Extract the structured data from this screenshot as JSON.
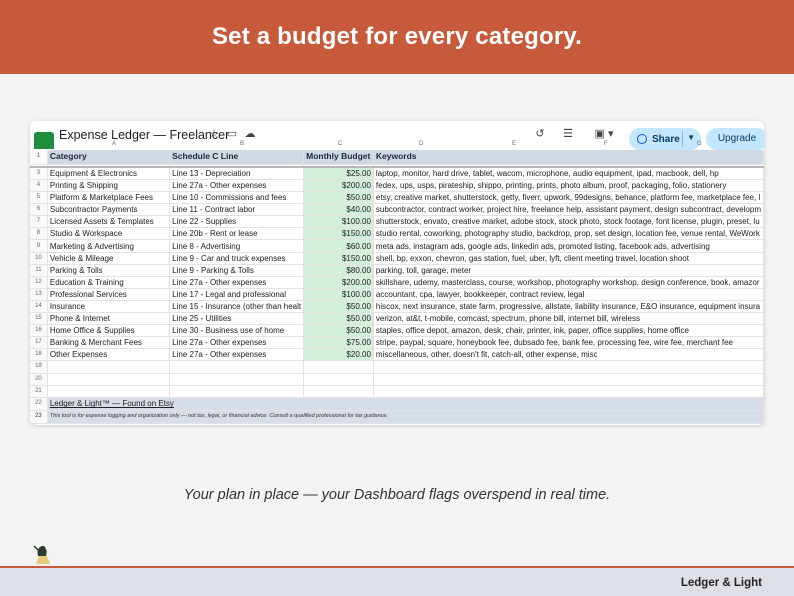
{
  "banner": {
    "title": "Set a budget for every category."
  },
  "app": {
    "doc_title": "Expense Ledger — Freelancer",
    "share_label": "Share",
    "upgrade_label": "Upgrade"
  },
  "columns": {
    "a": "A",
    "b": "B",
    "c": "C",
    "d": "D",
    "e": "E",
    "f": "F",
    "g": "G"
  },
  "sheet": {
    "header": {
      "row": "1",
      "category": "Category",
      "schedule": "Schedule C Line",
      "budget": "Monthly Budget",
      "keywords": "Keywords"
    },
    "rows": [
      {
        "n": "3",
        "category": "Equipment & Electronics",
        "schedule": "Line 13 - Depreciation",
        "budget": "$25.00",
        "keywords": "laptop, monitor, hard drive, tablet, wacom, microphone, audio equipment, ipad, macbook, dell, hp"
      },
      {
        "n": "4",
        "category": "Printing & Shipping",
        "schedule": "Line 27a - Other expenses",
        "budget": "$200.00",
        "keywords": "fedex, ups, usps, pirateship, shippo, printing, prints, photo album, proof, packaging, folio, stationery"
      },
      {
        "n": "5",
        "category": "Platform & Marketplace Fees",
        "schedule": "Line 10 - Commissions and fees",
        "budget": "$50.00",
        "keywords": "etsy, creative market, shutterstock, getty, fiverr, upwork, 99designs, behance, platform fee, marketplace fee, l"
      },
      {
        "n": "6",
        "category": "Subcontractor Payments",
        "schedule": "Line 11 - Contract labor",
        "budget": "$40.00",
        "keywords": "subcontractor, contract worker, project hire, freelance help, assistant payment, design subcontract, developm"
      },
      {
        "n": "7",
        "category": "Licensed Assets & Templates",
        "schedule": "Line 22 - Supplies",
        "budget": "$100.00",
        "keywords": "shutterstock, envato, creative market, adobe stock, stock photo, stock footage, font license, plugin, preset, lu"
      },
      {
        "n": "8",
        "category": "Studio & Workspace",
        "schedule": "Line 20b - Rent or lease",
        "budget": "$150.00",
        "keywords": "studio rental, coworking, photography studio, backdrop, prop, set design, location fee, venue rental, WeWork"
      },
      {
        "n": "9",
        "category": "Marketing & Advertising",
        "schedule": "Line 8 - Advertising",
        "budget": "$60.00",
        "keywords": "meta ads, instagram ads, google ads, linkedin ads, promoted listing, facebook ads, advertising"
      },
      {
        "n": "10",
        "category": "Vehicle & Mileage",
        "schedule": "Line 9 - Car and truck expenses",
        "budget": "$150.00",
        "keywords": "shell, bp, exxon, chevron, gas station, fuel, uber, lyft, client meeting travel, location shoot"
      },
      {
        "n": "11",
        "category": "Parking & Tolls",
        "schedule": "Line 9 - Parking & Tolls",
        "budget": "$80.00",
        "keywords": "parking, toll, garage, meter"
      },
      {
        "n": "12",
        "category": "Education & Training",
        "schedule": "Line 27a - Other expenses",
        "budget": "$200.00",
        "keywords": "skillshare, udemy, masterclass, course, workshop, photography workshop, design conference, book, amazor"
      },
      {
        "n": "13",
        "category": "Professional Services",
        "schedule": "Line 17 - Legal and professional",
        "budget": "$100.00",
        "keywords": "accountant, cpa, lawyer, bookkeeper, contract review, legal"
      },
      {
        "n": "14",
        "category": "Insurance",
        "schedule": "Line 15 - Insurance (other than healt",
        "budget": "$50.00",
        "keywords": "hiscox, next insurance, state farm, progressive, allstate, liability insurance, E&O insurance, equipment insura"
      },
      {
        "n": "15",
        "category": "Phone & Internet",
        "schedule": "Line 25 - Utilities",
        "budget": "$50.00",
        "keywords": "verizon, at&t, t-mobile, comcast, spectrum, phone bill, internet bill, wireless"
      },
      {
        "n": "16",
        "category": "Home Office & Supplies",
        "schedule": "Line 30 - Business use of home",
        "budget": "$50.00",
        "keywords": "staples, office depot, amazon, desk, chair, printer, ink, paper, office supplies, home office"
      },
      {
        "n": "17",
        "category": "Banking & Merchant Fees",
        "schedule": "Line 27a - Other expenses",
        "budget": "$75.00",
        "keywords": "stripe, paypal, square, honeybook fee, dubsado fee, bank fee, processing fee, wire fee, merchant fee"
      },
      {
        "n": "18",
        "category": "Other Expenses",
        "schedule": "Line 27a - Other expenses",
        "budget": "$20.00",
        "keywords": "miscellaneous, other, doesn't fit, catch-all, other expense, misc"
      }
    ],
    "empty_rows": [
      "19",
      "20",
      "21"
    ],
    "brand_row": {
      "n": "22",
      "text": "Ledger & Light™  —  Found on Etsy"
    },
    "disclaimer_row": {
      "n": "23",
      "text": "This tool is for expense logging and organization only — not tax, legal, or financial advice. Consult a qualified professional for tax guidance."
    }
  },
  "caption": "Your plan in place — your Dashboard flags overspend in real time.",
  "footer": {
    "brand": "Ledger & Light"
  },
  "colors": {
    "accent": "#c85a3c",
    "budget_fill": "#d4efdc",
    "header_fill": "#cfd8e3",
    "footer_bg": "#dde1e7"
  }
}
